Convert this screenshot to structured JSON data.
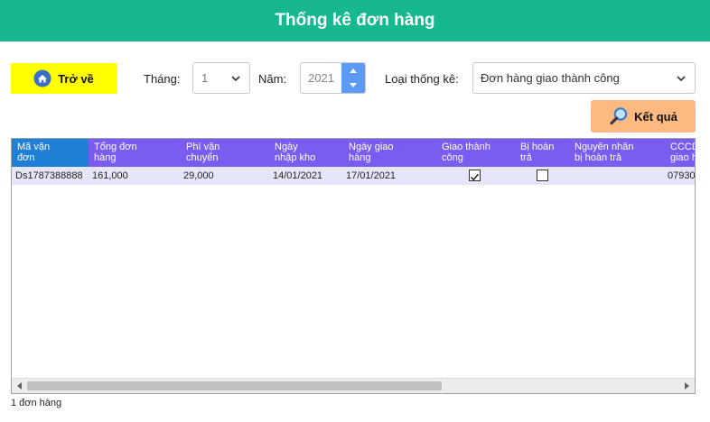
{
  "header": {
    "title": "Thống kê đơn hàng"
  },
  "toolbar": {
    "back_label": "Trở về",
    "month_label": "Tháng:",
    "month_value": "1",
    "year_label": "Năm:",
    "year_value": "2021",
    "type_label": "Loại thống kê:",
    "type_value": "Đơn hàng giao thành công",
    "result_label": "Kết quả"
  },
  "table": {
    "columns": [
      "Mã vận\nđơn",
      "Tổng đơn\nhàng",
      "Phí vận\nchuyển",
      "Ngày\nnhập kho",
      "Ngày giao\nhàng",
      "Giao thành\ncông",
      "Bị hoàn\ntrả",
      "Nguyên nhân\nbị hoàn trả",
      "CCCD\ngiao h"
    ],
    "rows": [
      {
        "ma_van_don": "Ds1787388888",
        "tong_don_hang": "161,000",
        "phi_van_chuyen": "29,000",
        "ngay_nhap_kho": "14/01/2021",
        "ngay_giao_hang": "17/01/2021",
        "giao_thanh_cong": true,
        "bi_hoan_tra": false,
        "nguyen_nhan": "",
        "cccd": "07930"
      }
    ]
  },
  "footer": {
    "count_text": "1 đơn hàng"
  },
  "colors": {
    "header_bg": "#17b890",
    "back_button": "#ffff00",
    "result_button": "#fdb97f",
    "grid_header": "#7b5cf0",
    "grid_header_selected": "#1f7fd6",
    "row_bg": "#e6e6fa",
    "spin_accent": "#5b9bf5"
  },
  "icons": {
    "back": "home-icon",
    "result": "magnifier-icon",
    "month_dropdown": "chevron-down-icon",
    "type_dropdown": "chevron-down-icon"
  }
}
